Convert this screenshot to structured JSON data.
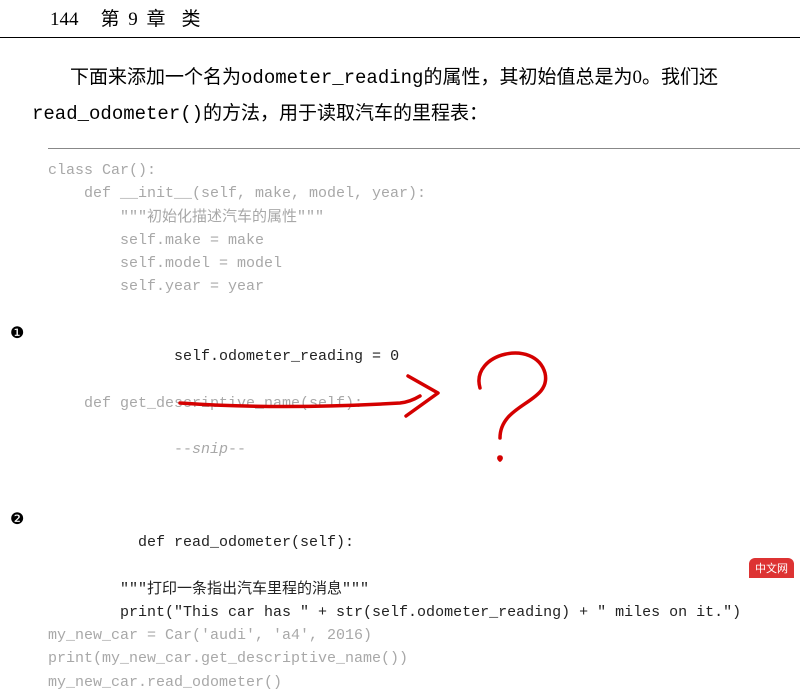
{
  "header": {
    "page_number": "144",
    "chapter_label": "第 9 章",
    "chapter_title": "类"
  },
  "prose": {
    "line1_a": "下面来添加一个名为",
    "line1_code": "odometer_reading",
    "line1_b": "的属性，其初始值总是为0。我们还",
    "line2_code": "read_odometer()",
    "line2_b": "的方法，用于读取汽车的里程表："
  },
  "code": {
    "l01": "class Car():",
    "l02": "",
    "l03": "    def __init__(self, make, model, year):",
    "l04": "        \"\"\"初始化描述汽车的属性\"\"\"",
    "l05": "        self.make = make",
    "l06": "        self.model = model",
    "l07": "        self.year = year",
    "l08": "        self.odometer_reading = 0",
    "l09": "",
    "l10": "    def get_descriptive_name(self):",
    "l11_a": "        --",
    "l11_snip": "snip",
    "l11_b": "--",
    "l12": "",
    "l13": "    def read_odometer(self):",
    "l14": "        \"\"\"打印一条指出汽车里程的消息\"\"\"",
    "l15": "        print(\"This car has \" + str(self.odometer_reading) + \" miles on it.\")",
    "l16": "",
    "l17": "my_new_car = Car('audi', 'a4', 2016)",
    "l18": "print(my_new_car.get_descriptive_name())",
    "l19": "my_new_car.read_odometer()"
  },
  "markers": {
    "m1": "❶",
    "m2": "❷"
  },
  "watermark": "中文网"
}
